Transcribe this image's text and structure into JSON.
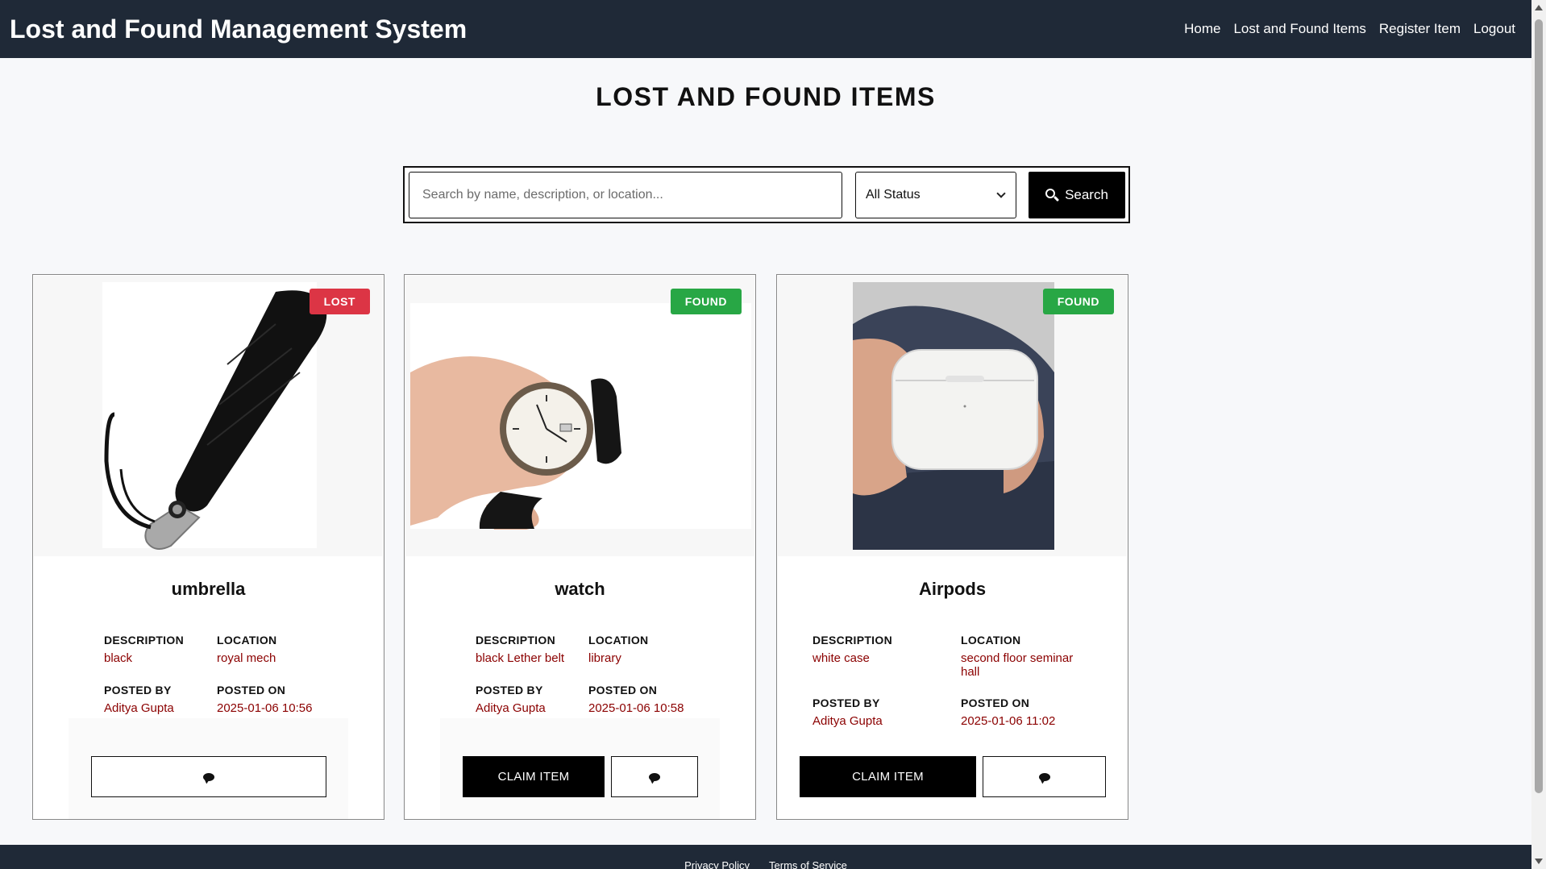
{
  "brand": "Lost and Found Management System",
  "nav": [
    "Home",
    "Lost and Found Items",
    "Register Item",
    "Logout"
  ],
  "page_title": "LOST AND FOUND ITEMS",
  "search": {
    "placeholder": "Search by name, description, or location...",
    "status_selected": "All Status",
    "button_label": "Search"
  },
  "labels": {
    "description": "DESCRIPTION",
    "location": "LOCATION",
    "posted_by": "POSTED BY",
    "posted_on": "POSTED ON",
    "claim": "CLAIM ITEM"
  },
  "items": [
    {
      "name": "umbrella",
      "status": "LOST",
      "description": "black",
      "location": "royal mech",
      "posted_by": "Aditya Gupta",
      "posted_on": "2025-01-06 10:56"
    },
    {
      "name": "watch",
      "status": "FOUND",
      "description": "black Lether belt",
      "location": "library",
      "posted_by": "Aditya Gupta",
      "posted_on": "2025-01-06 10:58"
    },
    {
      "name": "Airpods",
      "status": "FOUND",
      "description": "white case",
      "location": "second floor seminar hall",
      "posted_by": "Aditya Gupta",
      "posted_on": "2025-01-06 11:02"
    }
  ],
  "footer": [
    "Privacy Policy",
    "Terms of Service"
  ],
  "colors": {
    "navbar": "#1f2937",
    "lost": "#dc3545",
    "found": "#28a745",
    "value_text": "#8b0000"
  }
}
